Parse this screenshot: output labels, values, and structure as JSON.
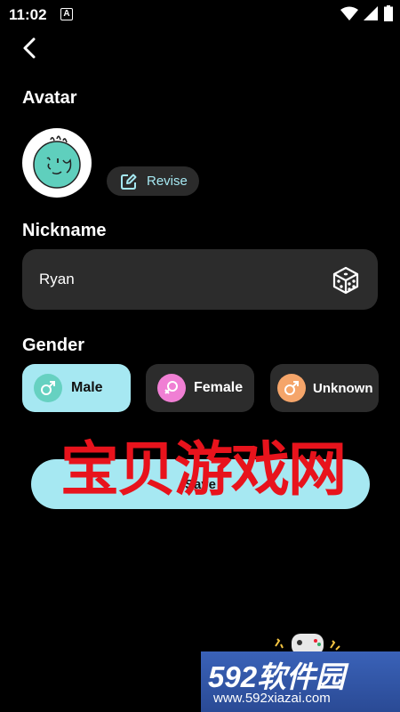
{
  "status_bar": {
    "time": "11:02",
    "notification_badge": "A"
  },
  "avatar_section": {
    "title": "Avatar",
    "revise_label": "Revise"
  },
  "nickname_section": {
    "title": "Nickname",
    "value": "Ryan"
  },
  "gender_section": {
    "title": "Gender",
    "options": [
      {
        "label": "Male",
        "symbol": "♂",
        "color": "#66d1c1",
        "selected": true
      },
      {
        "label": "Female",
        "symbol": "♀",
        "color": "#f07fd4",
        "selected": false
      },
      {
        "label": "Unknown",
        "symbol": "♂",
        "color": "#f5a56a",
        "selected": false
      }
    ]
  },
  "save_label": "Save",
  "watermarks": {
    "overlay_text": "宝贝游戏网",
    "site_name": "592软件园",
    "site_url": "www.592xiazai.com"
  },
  "colors": {
    "accent": "#a6e8f2",
    "field_bg": "#2c2c2c",
    "background": "#000000",
    "avatar_face": "#5fcfbd"
  }
}
